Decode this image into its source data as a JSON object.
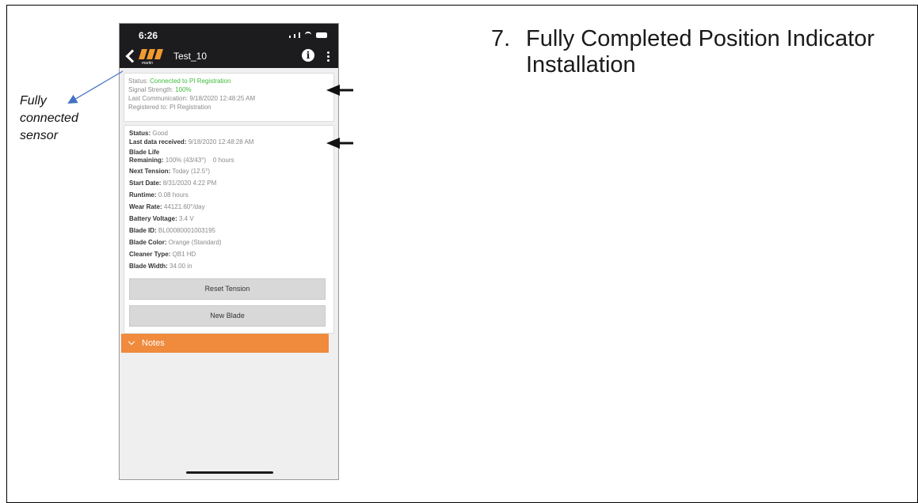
{
  "step": {
    "number": "7.",
    "title": "Fully Completed Position Indicator Installation"
  },
  "callout": {
    "line1": "Fully",
    "line2": "connected",
    "line3": "sensor"
  },
  "phone": {
    "time": "6:26",
    "app_title": "Test_10",
    "logo_text": "martin",
    "info_icon": "info-icon",
    "connection": {
      "status_label": "Status:",
      "status_value": "Connected to PI Registration",
      "signal_label": "Signal Strength:",
      "signal_value": "100%",
      "last_comm": "Last Communication: 9/18/2020 12:48:25 AM",
      "registered": "Registered to: PI Registration"
    },
    "blade": {
      "status_label": "Status:",
      "status_value": "Good",
      "last_data_label": "Last data received:",
      "last_data_value": "9/18/2020 12:48:28 AM",
      "blade_life_label": "Blade Life",
      "remaining_label": "Remaining:",
      "remaining_value": "100% (43/43°)",
      "remaining_hours": "0 hours",
      "next_tension_label": "Next Tension:",
      "next_tension_value": "Today (12.5°)",
      "start_date_label": "Start Date:",
      "start_date_value": "8/31/2020 4:22 PM",
      "runtime_label": "Runtime:",
      "runtime_value": "0.08 hours",
      "wear_rate_label": "Wear Rate:",
      "wear_rate_value": "44121.60°/day",
      "battery_label": "Battery Voltage:",
      "battery_value": "3.4 V",
      "blade_id_label": "Blade ID:",
      "blade_id_value": "BL00080001003195",
      "blade_color_label": "Blade Color:",
      "blade_color_value": "Orange (Standard)",
      "cleaner_label": "Cleaner Type:",
      "cleaner_value": "QB1 HD",
      "width_label": "Blade Width:",
      "width_value": "34.00 in"
    },
    "buttons": {
      "reset": "Reset Tension",
      "new_blade": "New Blade"
    },
    "notes_label": "Notes"
  },
  "colors": {
    "accent_orange": "#f08a3c",
    "status_green": "#3dbb3d",
    "callout_arrow": "#4472c4"
  }
}
